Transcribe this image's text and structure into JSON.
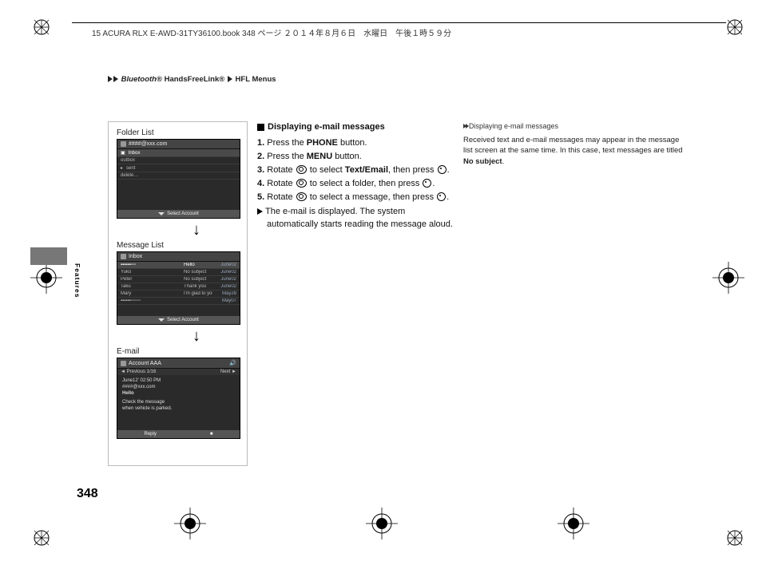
{
  "header_line": "15 ACURA RLX E-AWD-31TY36100.book  348 ページ   ２０１４年８月６日　水曜日　午後１時５９分",
  "breadcrumb": {
    "p1": "Bluetooth",
    "p1_reg": "®",
    "p2": " HandsFreeLink",
    "p2_reg": "®",
    "p3": "HFL Menus"
  },
  "side_label": "Features",
  "page_number": "348",
  "box": {
    "title1": "Folder List",
    "shot1": {
      "account": "####@xxx.com",
      "items": [
        "Inbox",
        "outbox",
        "sent",
        "delete…"
      ],
      "foot": "Select Account"
    },
    "title2": "Message List",
    "shot2": {
      "account": "Inbox",
      "rows": [
        {
          "a": "▪▪▪▪▪▪▫▫▫",
          "b": "Hello",
          "c": "June02"
        },
        {
          "a": "Yuko",
          "b": "No subject",
          "c": "June02"
        },
        {
          "a": "Peter",
          "b": "No subject",
          "c": "June02"
        },
        {
          "a": "Taku",
          "b": "Thank you",
          "c": "June02"
        },
        {
          "a": "Mary",
          "b": "I'm glad to you",
          "c": "May28"
        },
        {
          "a": "▪▪▪▪▪▪▫▫▫▫▫▫",
          "b": "",
          "c": "May07"
        }
      ],
      "foot": "Select Account"
    },
    "title3": "E-mail",
    "shot3": {
      "account": "Account AAA",
      "nav_l": "◄ Previous   1/16",
      "nav_r": "Next ►",
      "line1": "June12' 02:50 PM",
      "line2": "####@xxx.com",
      "line3": "Hello",
      "line4": "Check the message",
      "line5": "when vehicle is parked.",
      "reply": "Reply",
      "stop": "■"
    }
  },
  "steps": {
    "title": "Displaying e-mail messages",
    "s1a": "1.",
    "s1b": " Press the ",
    "s1c": "PHONE",
    "s1d": " button.",
    "s2a": "2.",
    "s2b": " Press the ",
    "s2c": "MENU",
    "s2d": " button.",
    "s3a": "3.",
    "s3b": " Rotate ",
    "s3c": " to select ",
    "s3d": "Text/Email",
    "s3e": ", then press ",
    "s4a": "4.",
    "s4b": " Rotate ",
    "s4c": " to select a folder, then press ",
    "s5a": "5.",
    "s5b": " Rotate ",
    "s5c": " to select a message, then press ",
    "out": "The e-mail is displayed. The system automatically starts reading the message aloud."
  },
  "info": {
    "hd": "Displaying e-mail messages",
    "body_a": "Received text and e-mail messages may appear in the message list screen at the same time. In this case, text messages are titled ",
    "body_b": "No subject",
    "body_c": "."
  }
}
